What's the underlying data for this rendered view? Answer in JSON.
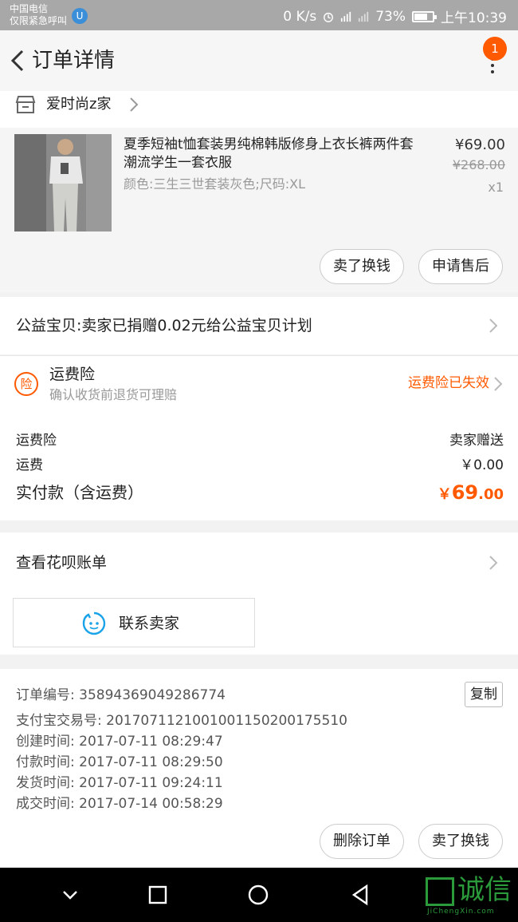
{
  "status_bar": {
    "carrier_line1": "中国电信",
    "carrier_line2": "仅限紧急呼叫",
    "speed": "0 K/s",
    "battery_percent": "73%",
    "battery_level": 0.73,
    "time": "上午10:39"
  },
  "header": {
    "title": "订单详情",
    "notification_count": "1"
  },
  "shop": {
    "name": "爱时尚z家"
  },
  "product": {
    "title": "夏季短袖t恤套装男纯棉韩版修身上衣长裤两件套潮流学生一套衣服",
    "sku": "颜色:三生三世套装灰色;尺码:XL",
    "price": "¥69.00",
    "original_price": "¥268.00",
    "quantity": "x1",
    "sell_button": "卖了换钱",
    "aftersale_button": "申请售后"
  },
  "charity": {
    "text": "公益宝贝:卖家已捐赠0.02元给公益宝贝计划"
  },
  "insurance": {
    "icon_text": "险",
    "title": "运费险",
    "subtitle": "确认收货前退货可理赔",
    "status": "运费险已失效"
  },
  "costs": {
    "insurance_label": "运费险",
    "insurance_value": "卖家赠送",
    "shipping_label": "运费",
    "shipping_value": "￥0.00",
    "total_label": "实付款（含运费）",
    "total_currency": "￥",
    "total_integer": "69",
    "total_decimal": ".00"
  },
  "huabei": {
    "label": "查看花呗账单",
    "contact_button": "联系卖家"
  },
  "order_info": {
    "order_no": "订单编号: 35894369049286774",
    "alipay_no": "支付宝交易号: 2017071121001001150200175510",
    "created": "创建时间: 2017-07-11 08:29:47",
    "paid": "付款时间: 2017-07-11 08:29:50",
    "shipped": "发货时间: 2017-07-11 09:24:11",
    "completed": "成交时间: 2017-07-14 00:58:29",
    "copy_button": "复制",
    "delete_button": "删除订单",
    "sell_button": "卖了换钱"
  },
  "watermark": {
    "text": "诚信",
    "sub": "JiChengXin.com"
  },
  "colors": {
    "accent": "#ff5a00",
    "watermark": "#2a9a3a"
  }
}
